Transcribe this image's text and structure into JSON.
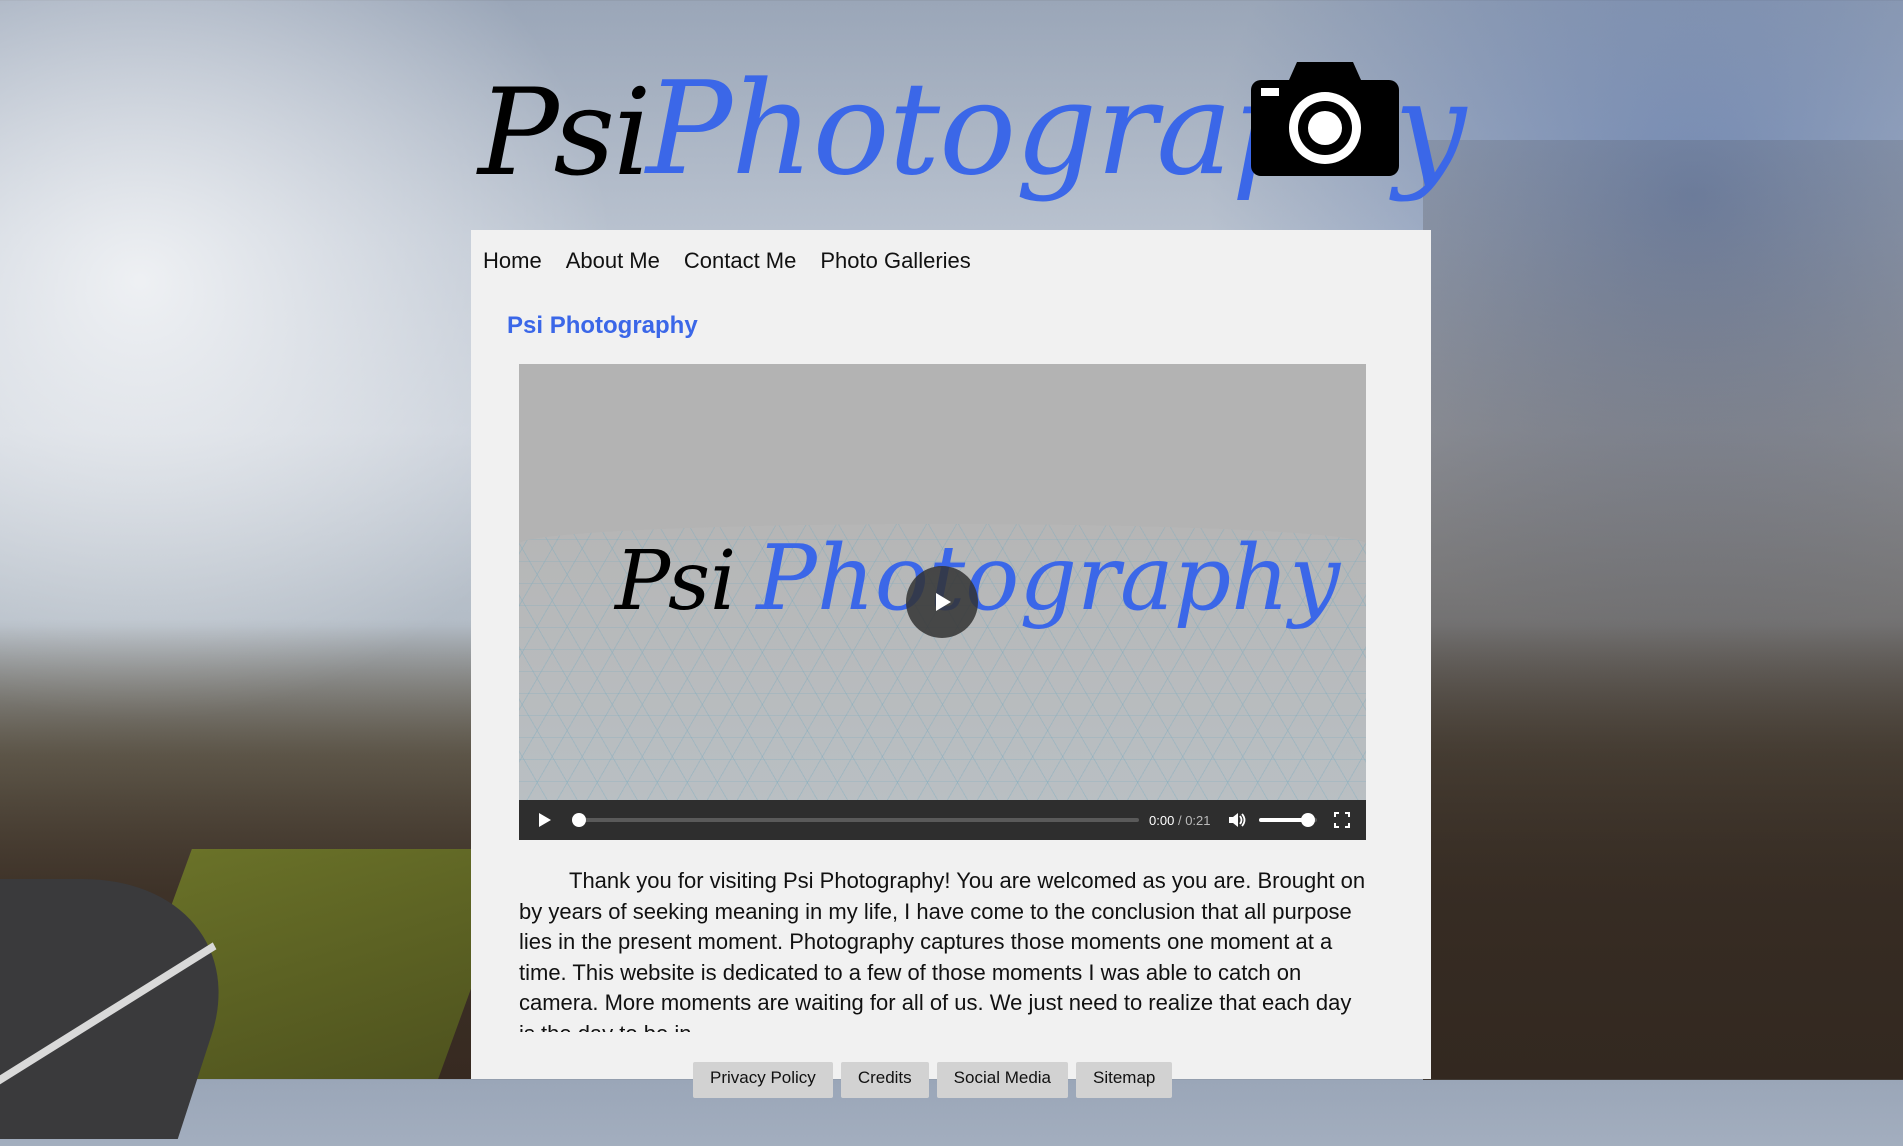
{
  "header": {
    "logo_part1": "Psi",
    "logo_part2": "Photography",
    "logo_icon": "camera-icon",
    "brand_color": "#3b67e8"
  },
  "nav": {
    "items": [
      "Home",
      "About Me",
      "Contact Me",
      "Photo Galleries"
    ]
  },
  "main": {
    "title": "Psi Photography",
    "video": {
      "poster_text_part1": "Psi",
      "poster_text_part2": "Photography",
      "current_time": "0:00",
      "separator": "/",
      "duration": "0:21",
      "progress": 0.01,
      "volume": 0.85,
      "icons": [
        "play-icon",
        "volume-icon",
        "fullscreen-icon"
      ]
    },
    "intro_text": "Thank you for visiting Psi Photography! You are welcomed as you are. Brought on by years of seeking meaning in my life, I have come to the conclusion that all purpose lies in the present moment. Photography captures those moments one moment at a time. This website is dedicated to a few of those moments I was able to catch on camera. More moments are waiting for all of us. We just need to realize that each day is the day to be in."
  },
  "footer": {
    "links": [
      "Privacy Policy",
      "Credits",
      "Social Media",
      "Sitemap"
    ]
  }
}
